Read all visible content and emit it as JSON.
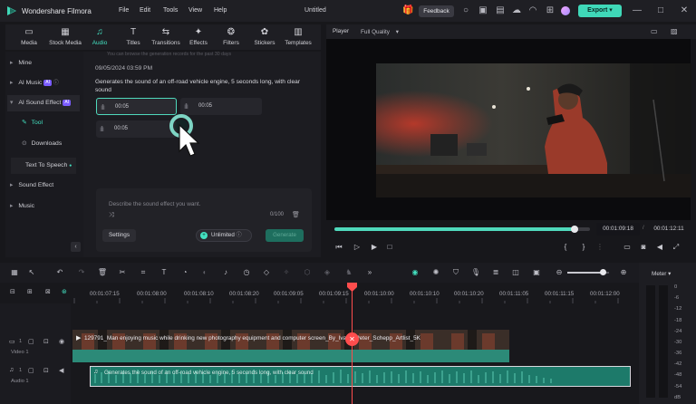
{
  "app": {
    "name": "Wondershare Filmora",
    "document_title": "Untitled"
  },
  "menu": [
    "File",
    "Edit",
    "Tools",
    "View",
    "Help"
  ],
  "titlebar": {
    "feedback_label": "Feedback",
    "export_label": "Export"
  },
  "tabs": [
    {
      "label": "Media",
      "icon": "media-icon"
    },
    {
      "label": "Stock Media",
      "icon": "stock-media-icon"
    },
    {
      "label": "Audio",
      "icon": "audio-icon",
      "active": true
    },
    {
      "label": "Titles",
      "icon": "titles-icon"
    },
    {
      "label": "Transitions",
      "icon": "transitions-icon"
    },
    {
      "label": "Effects",
      "icon": "effects-icon"
    },
    {
      "label": "Filters",
      "icon": "filters-icon"
    },
    {
      "label": "Stickers",
      "icon": "stickers-icon"
    },
    {
      "label": "Templates",
      "icon": "templates-icon"
    }
  ],
  "sidebar": {
    "items": [
      {
        "label": "Mine"
      },
      {
        "label": "AI Music",
        "badge": "AI"
      },
      {
        "label": "AI Sound Effect",
        "badge": "AI"
      },
      {
        "label": "Tool"
      },
      {
        "label": "Downloads"
      },
      {
        "label": "Text To Speech"
      },
      {
        "label": "Sound Effect"
      },
      {
        "label": "Music"
      }
    ]
  },
  "sound_effect": {
    "tip": "You can browse the generation records for the past 30 days",
    "datetime": "09/05/2024 03:59 PM",
    "prompt": "Generates the sound of an off-road vehicle engine, 5 seconds long, with clear sound",
    "clips": [
      "00:05",
      "00:05",
      "00:05"
    ],
    "input_placeholder": "Describe the sound effect you want.",
    "counter": "0/100",
    "settings_label": "Settings",
    "unlimited_label": "Unlimited",
    "generate_label": "Generate"
  },
  "player": {
    "label": "Player",
    "quality": "Full Quality",
    "current_time": "00:01:09:18",
    "total_time": "00:01:12:11",
    "progress": 0.955
  },
  "timeline": {
    "ruler": [
      "00:01:07:15",
      "00:01:08:00",
      "00:01:08:10",
      "00:01:08:20",
      "00:01:09:05",
      "00:01:09:15",
      "00:01:10:00",
      "00:01:10:10",
      "00:01:10:20",
      "00:01:11:05",
      "00:01:11:15",
      "00:01:12:00"
    ],
    "video_track_label": "Video 1",
    "audio_track_label": "Audio 1",
    "video_track_num": "1",
    "audio_track_num": "1",
    "video_clip_title": "129791_Man enjoying music while drinking new photography equipment and computer screen_By_Ivans_Peter_Schepp_Artlist_5K",
    "audio_clip_title": "Generates the sound of an off-road vehicle engine, 5 seconds long, with clear sound"
  },
  "meter": {
    "title": "Meter",
    "labels": [
      "0",
      "-6",
      "-12",
      "-18",
      "-24",
      "-30",
      "-36",
      "-42",
      "-48",
      "-54"
    ],
    "unit": "dB"
  },
  "colors": {
    "accent": "#3fd8b8",
    "playhead": "#ff4d4d",
    "badge": "#7a5cff"
  }
}
